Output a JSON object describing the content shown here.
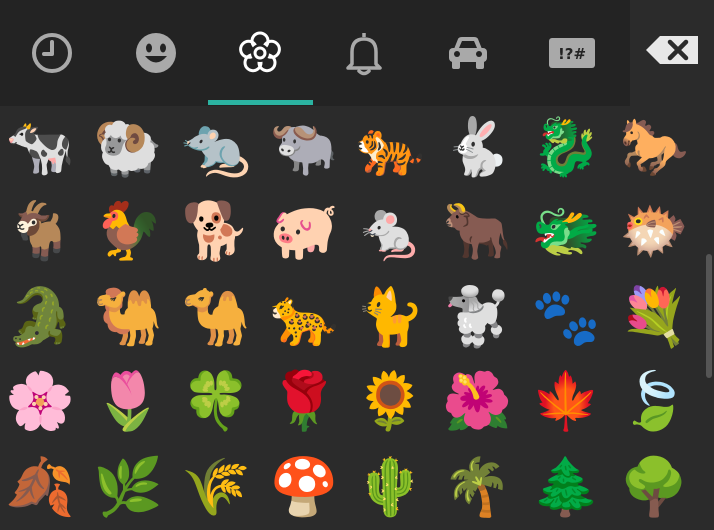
{
  "colors": {
    "tab_icon": "#a9a9a9",
    "accent": "#2bb3a1",
    "background": "#2b2b2b",
    "tabbar": "#232323"
  },
  "tabs": [
    {
      "name": "recent",
      "icon": "clock-icon"
    },
    {
      "name": "smileys",
      "icon": "smiley-icon"
    },
    {
      "name": "nature",
      "icon": "flower-icon",
      "selected": true
    },
    {
      "name": "objects",
      "icon": "bell-icon"
    },
    {
      "name": "places",
      "icon": "car-icon"
    },
    {
      "name": "symbols",
      "icon": "symbols-icon",
      "label": "!?#"
    }
  ],
  "backspace": {
    "icon": "backspace-icon"
  },
  "emoji_rows": [
    [
      "🐄",
      "🐏",
      "🐀",
      "🐃",
      "🐅",
      "🐇",
      "🐉",
      "🐎"
    ],
    [
      "🐐",
      "🐓",
      "🐕",
      "🐖",
      "🐁",
      "🐂",
      "🐲",
      "🐡"
    ],
    [
      "🐊",
      "🐫",
      "🐪",
      "🐆",
      "🐈",
      "🐩",
      "🐾",
      "💐"
    ],
    [
      "🌸",
      "🌷",
      "🍀",
      "🌹",
      "🌻",
      "🌺",
      "🍁",
      "🍃"
    ],
    [
      "🍂",
      "🌿",
      "🌾",
      "🍄",
      "🌵",
      "🌴",
      "🌲",
      "🌳"
    ]
  ]
}
